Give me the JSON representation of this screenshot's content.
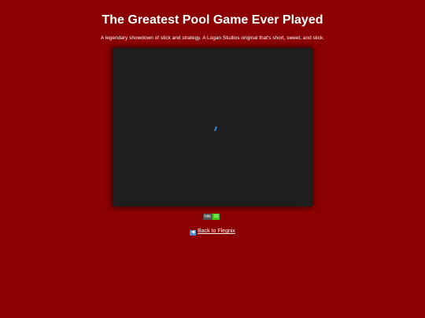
{
  "header": {
    "title": "The Greatest Pool Game Ever Played",
    "subtitle": "A legendary showdown of stick and strategy. A Logan Studios original that's short, sweet, and slick."
  },
  "game": {
    "background_color": "#1e1e1e",
    "cue_color": "#2f8fe0"
  },
  "hit_counter": {
    "label": "hits",
    "count": "33"
  },
  "footer": {
    "back_icon": "back-arrow-icon",
    "back_link_label": "Back to Flegnix"
  },
  "colors": {
    "page_background": "#8b0000",
    "text": "#ffffff",
    "badge_label_bg": "#555555",
    "badge_count_bg": "#44cc11"
  }
}
